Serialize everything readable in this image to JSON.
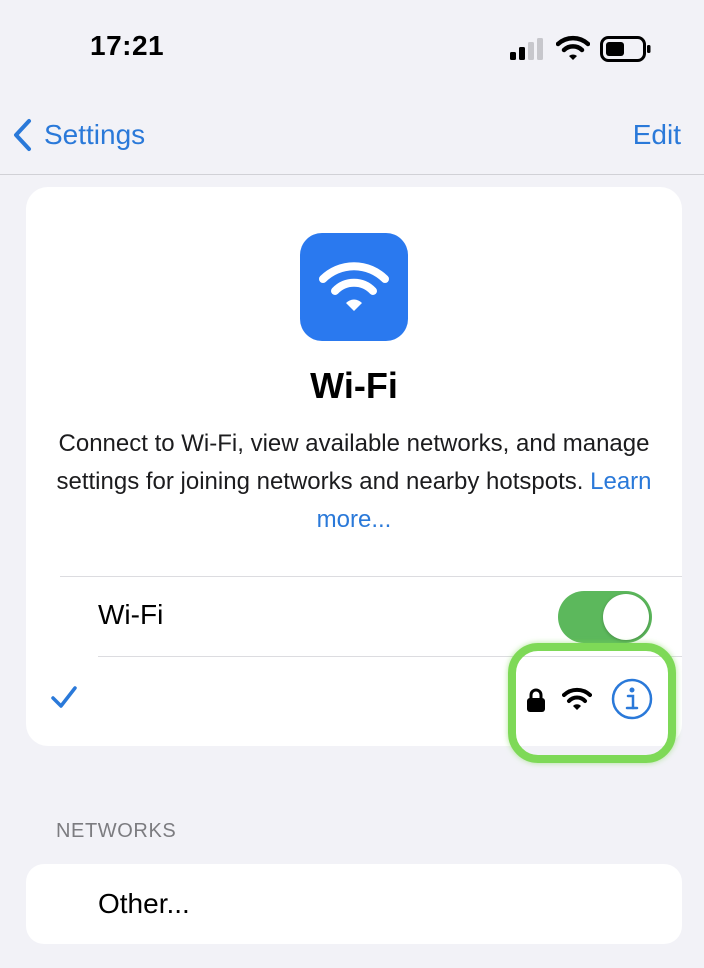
{
  "status_bar": {
    "time": "17:21"
  },
  "nav": {
    "back_label": "Settings",
    "edit_label": "Edit"
  },
  "header_card": {
    "title": "Wi-Fi",
    "description": "Connect to Wi-Fi, view available networks, and manage settings for joining networks and nearby hotspots.",
    "learn_more": "Learn more...",
    "wifi_label": "Wi-Fi",
    "wifi_enabled": true
  },
  "connected_network": {
    "name": "",
    "secured": true,
    "selected": true
  },
  "networks_section": {
    "header": "NETWORKS",
    "other_label": "Other..."
  },
  "colors": {
    "accent": "#2a79d9",
    "app_icon": "#2a79ef",
    "toggle_on": "#5cb85c",
    "highlight": "#7ed957",
    "background": "#f2f2f7"
  },
  "icons": [
    "signal-bars-icon",
    "wifi-icon",
    "battery-icon",
    "chevron-left-icon",
    "lock-icon",
    "info-icon",
    "checkmark-icon"
  ]
}
